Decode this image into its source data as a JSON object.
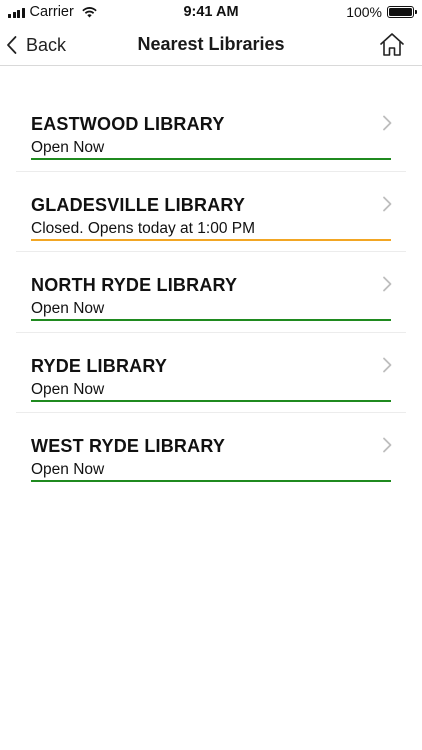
{
  "status_bar": {
    "carrier": "Carrier",
    "time": "9:41 AM",
    "battery": "100%"
  },
  "nav": {
    "back_label": "Back",
    "title": "Nearest Libraries"
  },
  "libraries": [
    {
      "name": "EASTWOOD LIBRARY",
      "status": "Open Now",
      "status_color": "#1f8a1f"
    },
    {
      "name": "GLADESVILLE LIBRARY",
      "status": "Closed. Opens today at 1:00 PM",
      "status_color": "#f2a623"
    },
    {
      "name": "NORTH RYDE LIBRARY",
      "status": "Open Now",
      "status_color": "#1f8a1f"
    },
    {
      "name": "RYDE LIBRARY",
      "status": "Open Now",
      "status_color": "#1f8a1f"
    },
    {
      "name": "WEST RYDE LIBRARY",
      "status": "Open Now",
      "status_color": "#1f8a1f"
    }
  ]
}
